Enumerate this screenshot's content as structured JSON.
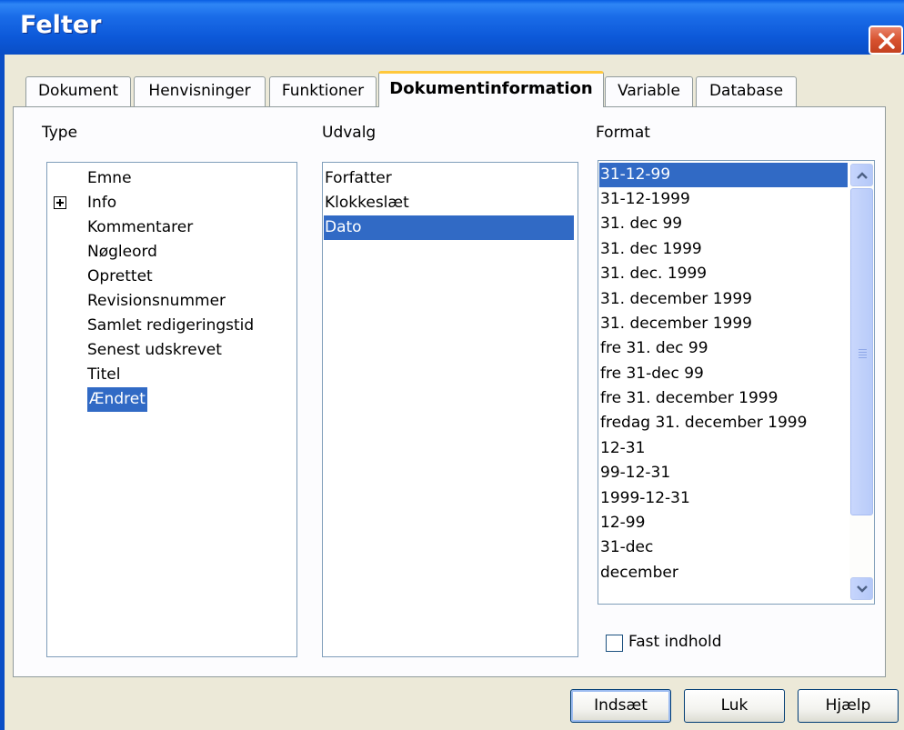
{
  "window": {
    "title": "Felter"
  },
  "tabs": [
    {
      "label": "Dokument"
    },
    {
      "label": "Henvisninger"
    },
    {
      "label": "Funktioner"
    },
    {
      "label": "Dokumentinformation",
      "active": true
    },
    {
      "label": "Variable"
    },
    {
      "label": "Database"
    }
  ],
  "type_group": {
    "label": "Type",
    "items": [
      {
        "label": "Emne"
      },
      {
        "label": "Info",
        "expandable": true
      },
      {
        "label": "Kommentarer"
      },
      {
        "label": "Nøgleord"
      },
      {
        "label": "Oprettet"
      },
      {
        "label": "Revisionsnummer"
      },
      {
        "label": "Samlet redigeringstid"
      },
      {
        "label": "Senest udskrevet"
      },
      {
        "label": "Titel"
      },
      {
        "label": "Ændret",
        "selected": true
      }
    ]
  },
  "select_group": {
    "label": "Udvalg",
    "items": [
      {
        "label": "Forfatter"
      },
      {
        "label": "Klokkeslæt"
      },
      {
        "label": "Dato",
        "selected": true
      }
    ]
  },
  "format_group": {
    "label": "Format",
    "items": [
      {
        "label": "31-12-99",
        "selected": true
      },
      {
        "label": "31-12-1999"
      },
      {
        "label": "31. dec 99"
      },
      {
        "label": "31. dec 1999"
      },
      {
        "label": "31. dec. 1999"
      },
      {
        "label": "31. december 1999"
      },
      {
        "label": "31. december 1999"
      },
      {
        "label": "fre 31. dec 99"
      },
      {
        "label": "fre 31-dec 99"
      },
      {
        "label": "fre 31. december 1999"
      },
      {
        "label": "fredag 31. december 1999"
      },
      {
        "label": "12-31"
      },
      {
        "label": "99-12-31"
      },
      {
        "label": "1999-12-31"
      },
      {
        "label": "12-99"
      },
      {
        "label": "31-dec"
      },
      {
        "label": "december"
      }
    ]
  },
  "fixed_content": {
    "label": "Fast indhold",
    "checked": false
  },
  "buttons": {
    "insert": "Indsæt",
    "close": "Luk",
    "help": "Hjælp"
  },
  "colors": {
    "selection": "#316ac5",
    "titlebar": "#0a5fe3",
    "dialog_bg": "#ece9d8"
  }
}
